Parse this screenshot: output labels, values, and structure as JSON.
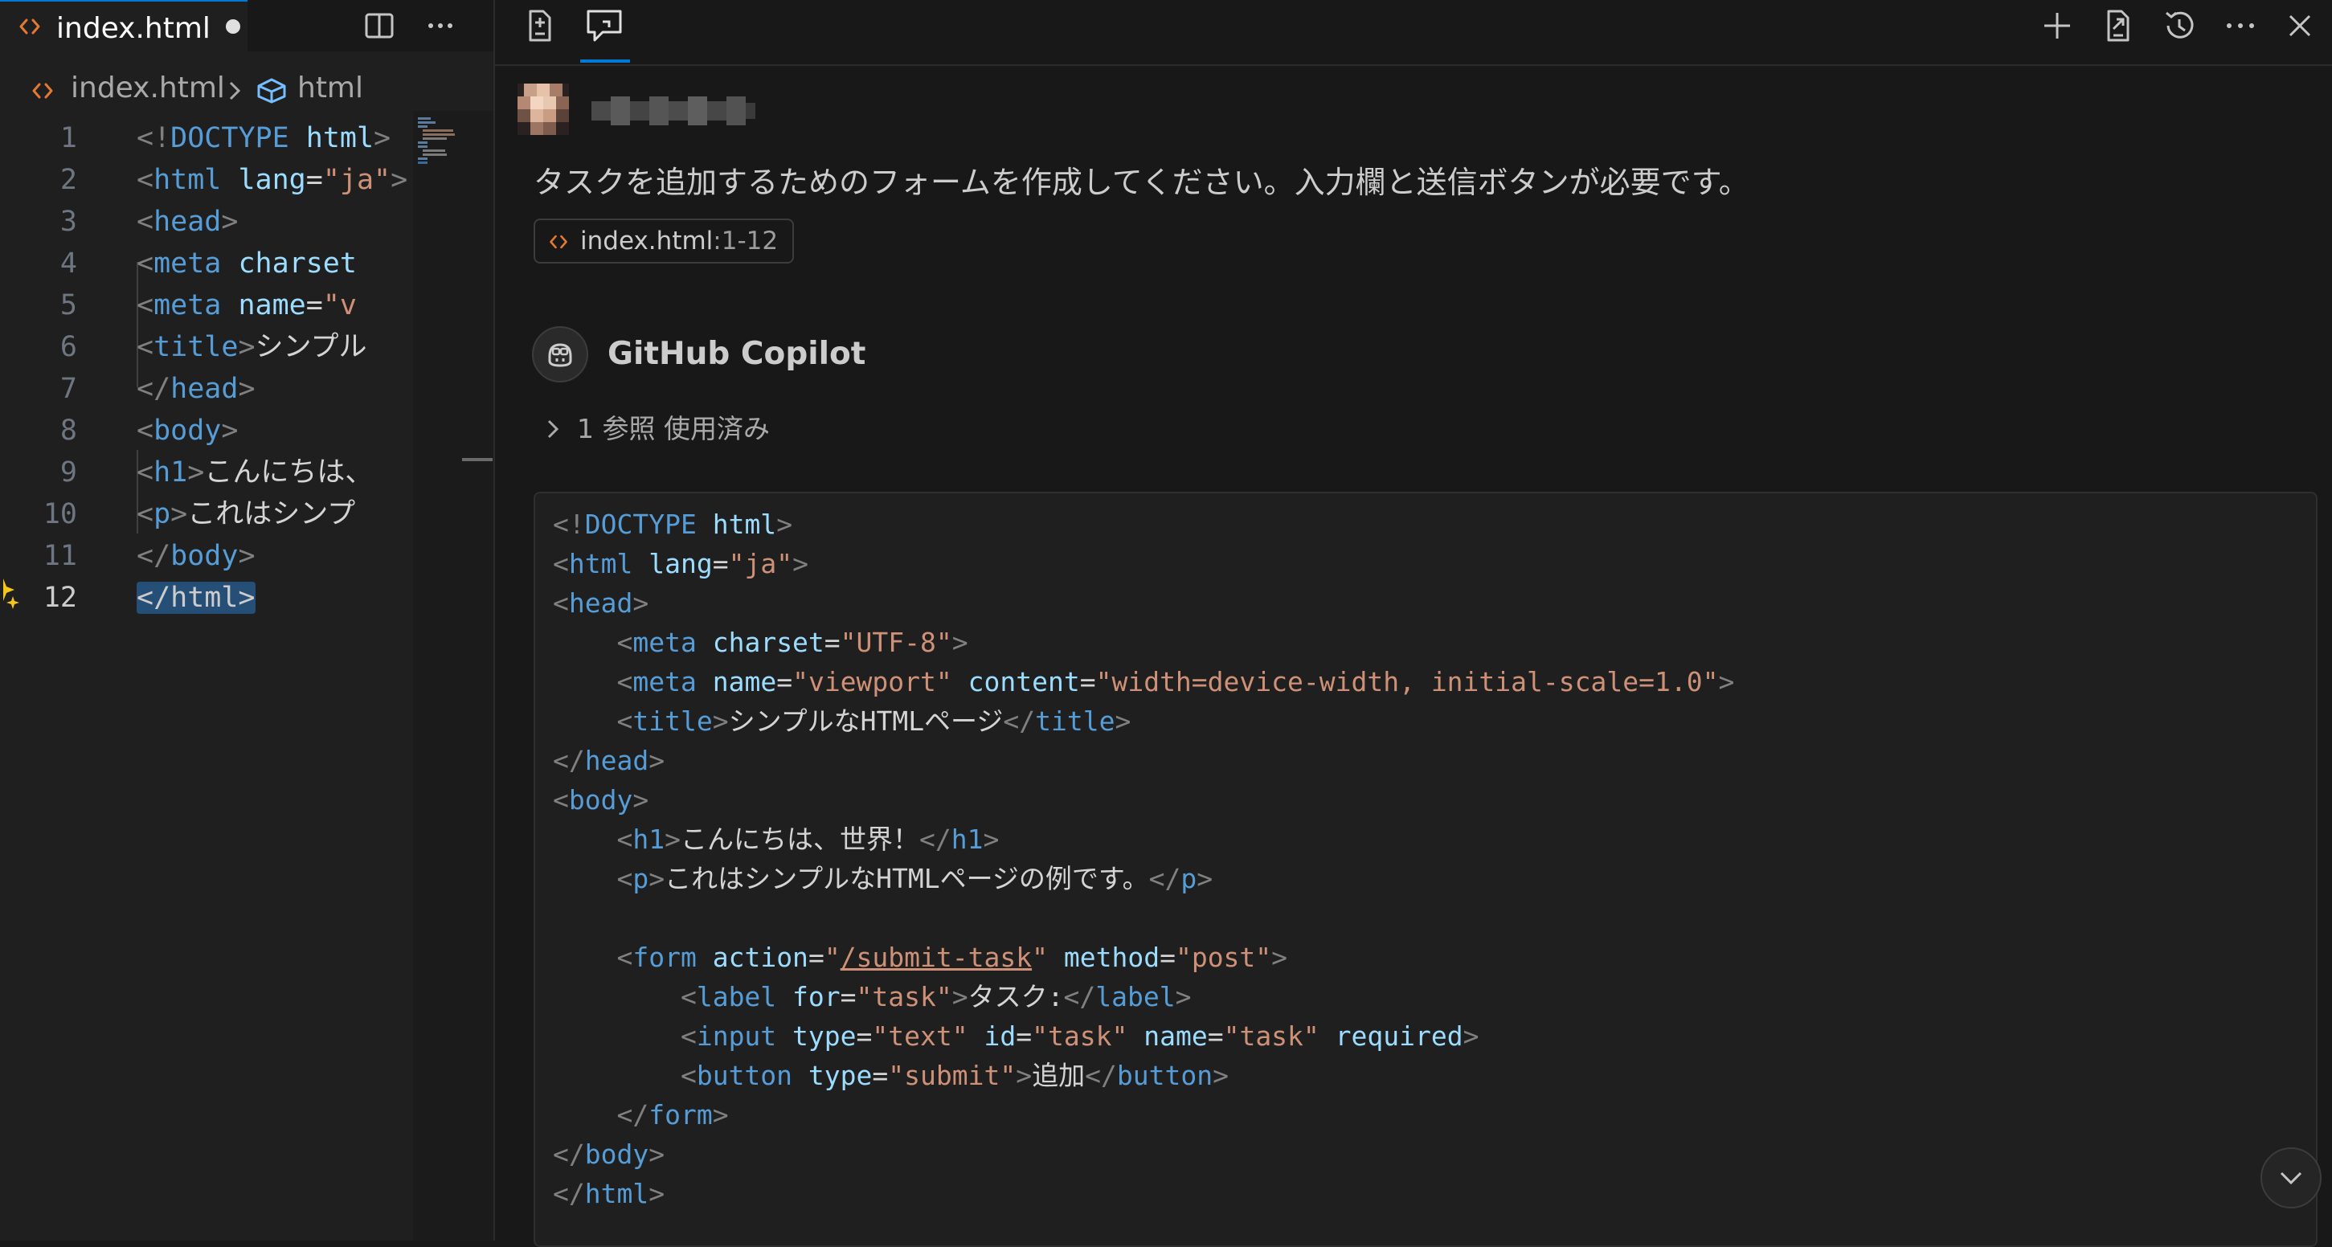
{
  "editor": {
    "tab": {
      "label": "index.html",
      "dirty": true
    },
    "breadcrumb": {
      "file": "index.html",
      "symbol": "html"
    },
    "active_line": 12,
    "lines": [
      {
        "n": "1",
        "tokens": [
          [
            "p",
            "<!"
          ],
          [
            "t",
            "DOCTYPE"
          ],
          [
            "tx",
            " "
          ],
          [
            "a",
            "html"
          ],
          [
            "p",
            ">"
          ]
        ]
      },
      {
        "n": "2",
        "tokens": [
          [
            "p",
            "<"
          ],
          [
            "t",
            "html"
          ],
          [
            "tx",
            " "
          ],
          [
            "a",
            "lang"
          ],
          [
            "tx",
            "="
          ],
          [
            "s",
            "\"ja\""
          ],
          [
            "p",
            ">"
          ]
        ]
      },
      {
        "n": "3",
        "tokens": [
          [
            "p",
            "<"
          ],
          [
            "t",
            "head"
          ],
          [
            "p",
            ">"
          ]
        ]
      },
      {
        "n": "4",
        "tokens": [
          [
            "tx",
            "    "
          ],
          [
            "p",
            "<"
          ],
          [
            "t",
            "meta"
          ],
          [
            "tx",
            " "
          ],
          [
            "a",
            "charset"
          ]
        ]
      },
      {
        "n": "5",
        "tokens": [
          [
            "tx",
            "    "
          ],
          [
            "p",
            "<"
          ],
          [
            "t",
            "meta"
          ],
          [
            "tx",
            " "
          ],
          [
            "a",
            "name"
          ],
          [
            "tx",
            "="
          ],
          [
            "s",
            "\"v"
          ]
        ]
      },
      {
        "n": "6",
        "tokens": [
          [
            "tx",
            "    "
          ],
          [
            "p",
            "<"
          ],
          [
            "t",
            "title"
          ],
          [
            "p",
            ">"
          ],
          [
            "tx",
            "シンプル"
          ]
        ]
      },
      {
        "n": "7",
        "tokens": [
          [
            "p",
            "</"
          ],
          [
            "t",
            "head"
          ],
          [
            "p",
            ">"
          ]
        ]
      },
      {
        "n": "8",
        "tokens": [
          [
            "p",
            "<"
          ],
          [
            "t",
            "body"
          ],
          [
            "p",
            ">"
          ]
        ]
      },
      {
        "n": "9",
        "tokens": [
          [
            "tx",
            "    "
          ],
          [
            "p",
            "<"
          ],
          [
            "t",
            "h1"
          ],
          [
            "p",
            ">"
          ],
          [
            "tx",
            "こんにちは、"
          ]
        ]
      },
      {
        "n": "10",
        "tokens": [
          [
            "tx",
            "    "
          ],
          [
            "p",
            "<"
          ],
          [
            "t",
            "p"
          ],
          [
            "p",
            ">"
          ],
          [
            "tx",
            "これはシンプ"
          ]
        ]
      },
      {
        "n": "11",
        "tokens": [
          [
            "p",
            "</"
          ],
          [
            "t",
            "body"
          ],
          [
            "p",
            ">"
          ]
        ]
      },
      {
        "n": "12",
        "tokens": [
          [
            "sel",
            "</html>"
          ]
        ]
      }
    ]
  },
  "chat": {
    "user_message": "タスクを追加するためのフォームを作成してください。入力欄と送信ボタンが必要です。",
    "reference": {
      "file": "index.html",
      "lines": ":1-12"
    },
    "assistant_name": "GitHub Copilot",
    "references_used": "1 参照 使用済み",
    "code_lines": [
      [
        [
          "p",
          "<!"
        ],
        [
          "t",
          "DOCTYPE"
        ],
        [
          "tx",
          " "
        ],
        [
          "a",
          "html"
        ],
        [
          "p",
          ">"
        ]
      ],
      [
        [
          "p",
          "<"
        ],
        [
          "t",
          "html"
        ],
        [
          "tx",
          " "
        ],
        [
          "a",
          "lang"
        ],
        [
          "tx",
          "="
        ],
        [
          "s",
          "\"ja\""
        ],
        [
          "p",
          ">"
        ]
      ],
      [
        [
          "p",
          "<"
        ],
        [
          "t",
          "head"
        ],
        [
          "p",
          ">"
        ]
      ],
      [
        [
          "tx",
          "    "
        ],
        [
          "p",
          "<"
        ],
        [
          "t",
          "meta"
        ],
        [
          "tx",
          " "
        ],
        [
          "a",
          "charset"
        ],
        [
          "tx",
          "="
        ],
        [
          "s",
          "\"UTF-8\""
        ],
        [
          "p",
          ">"
        ]
      ],
      [
        [
          "tx",
          "    "
        ],
        [
          "p",
          "<"
        ],
        [
          "t",
          "meta"
        ],
        [
          "tx",
          " "
        ],
        [
          "a",
          "name"
        ],
        [
          "tx",
          "="
        ],
        [
          "s",
          "\"viewport\""
        ],
        [
          "tx",
          " "
        ],
        [
          "a",
          "content"
        ],
        [
          "tx",
          "="
        ],
        [
          "s",
          "\"width=device-width, initial-scale=1.0\""
        ],
        [
          "p",
          ">"
        ]
      ],
      [
        [
          "tx",
          "    "
        ],
        [
          "p",
          "<"
        ],
        [
          "t",
          "title"
        ],
        [
          "p",
          ">"
        ],
        [
          "tx",
          "シンプルなHTMLページ"
        ],
        [
          "p",
          "</"
        ],
        [
          "t",
          "title"
        ],
        [
          "p",
          ">"
        ]
      ],
      [
        [
          "p",
          "</"
        ],
        [
          "t",
          "head"
        ],
        [
          "p",
          ">"
        ]
      ],
      [
        [
          "p",
          "<"
        ],
        [
          "t",
          "body"
        ],
        [
          "p",
          ">"
        ]
      ],
      [
        [
          "tx",
          "    "
        ],
        [
          "p",
          "<"
        ],
        [
          "t",
          "h1"
        ],
        [
          "p",
          ">"
        ],
        [
          "tx",
          "こんにちは、世界！"
        ],
        [
          "p",
          "</"
        ],
        [
          "t",
          "h1"
        ],
        [
          "p",
          ">"
        ]
      ],
      [
        [
          "tx",
          "    "
        ],
        [
          "p",
          "<"
        ],
        [
          "t",
          "p"
        ],
        [
          "p",
          ">"
        ],
        [
          "tx",
          "これはシンプルなHTMLページの例です。"
        ],
        [
          "p",
          "</"
        ],
        [
          "t",
          "p"
        ],
        [
          "p",
          ">"
        ]
      ],
      [],
      [
        [
          "tx",
          "    "
        ],
        [
          "p",
          "<"
        ],
        [
          "t",
          "form"
        ],
        [
          "tx",
          " "
        ],
        [
          "a",
          "action"
        ],
        [
          "tx",
          "="
        ],
        [
          "s",
          "\""
        ],
        [
          "su",
          "/submit-task"
        ],
        [
          "s",
          "\""
        ],
        [
          "tx",
          " "
        ],
        [
          "a",
          "method"
        ],
        [
          "tx",
          "="
        ],
        [
          "s",
          "\"post\""
        ],
        [
          "p",
          ">"
        ]
      ],
      [
        [
          "tx",
          "        "
        ],
        [
          "p",
          "<"
        ],
        [
          "t",
          "label"
        ],
        [
          "tx",
          " "
        ],
        [
          "a",
          "for"
        ],
        [
          "tx",
          "="
        ],
        [
          "s",
          "\"task\""
        ],
        [
          "p",
          ">"
        ],
        [
          "tx",
          "タスク:"
        ],
        [
          "p",
          "</"
        ],
        [
          "t",
          "label"
        ],
        [
          "p",
          ">"
        ]
      ],
      [
        [
          "tx",
          "        "
        ],
        [
          "p",
          "<"
        ],
        [
          "t",
          "input"
        ],
        [
          "tx",
          " "
        ],
        [
          "a",
          "type"
        ],
        [
          "tx",
          "="
        ],
        [
          "s",
          "\"text\""
        ],
        [
          "tx",
          " "
        ],
        [
          "a",
          "id"
        ],
        [
          "tx",
          "="
        ],
        [
          "s",
          "\"task\""
        ],
        [
          "tx",
          " "
        ],
        [
          "a",
          "name"
        ],
        [
          "tx",
          "="
        ],
        [
          "s",
          "\"task\""
        ],
        [
          "tx",
          " "
        ],
        [
          "a",
          "required"
        ],
        [
          "p",
          ">"
        ]
      ],
      [
        [
          "tx",
          "        "
        ],
        [
          "p",
          "<"
        ],
        [
          "t",
          "button"
        ],
        [
          "tx",
          " "
        ],
        [
          "a",
          "type"
        ],
        [
          "tx",
          "="
        ],
        [
          "s",
          "\"submit\""
        ],
        [
          "p",
          ">"
        ],
        [
          "tx",
          "追加"
        ],
        [
          "p",
          "</"
        ],
        [
          "t",
          "button"
        ],
        [
          "p",
          ">"
        ]
      ],
      [
        [
          "tx",
          "    "
        ],
        [
          "p",
          "</"
        ],
        [
          "t",
          "form"
        ],
        [
          "p",
          ">"
        ]
      ],
      [
        [
          "p",
          "</"
        ],
        [
          "t",
          "body"
        ],
        [
          "p",
          ">"
        ]
      ],
      [
        [
          "p",
          "</"
        ],
        [
          "t",
          "html"
        ],
        [
          "p",
          ">"
        ]
      ]
    ]
  },
  "colors": {
    "accent": "#0078d4",
    "tag": "#569cd6",
    "attribute": "#9cdcfe",
    "string": "#ce9178",
    "punctuation": "#808080",
    "file_icon": "#e37933",
    "sparkle": "#f5c518"
  },
  "icons": {
    "tab": "html-file-icon",
    "editor_actions": [
      "split-editor-icon",
      "more-actions-icon"
    ],
    "chat_tabs": [
      "edits-icon",
      "chat-icon"
    ],
    "chat_actions": [
      "plus-icon",
      "export-icon",
      "history-icon",
      "more-actions-icon",
      "close-icon"
    ],
    "scroll": "chevron-down-icon",
    "copilot": "copilot-icon"
  }
}
